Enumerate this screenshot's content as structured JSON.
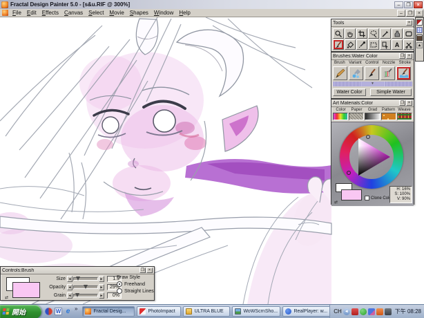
{
  "window": {
    "title": "Fractal Design Painter 5.0 - [s&u.RIF @ 300%]",
    "document": "s&u.RIF",
    "zoom_level": "300%"
  },
  "glyphs": {
    "minimize": "–",
    "restore": "❐",
    "close": "×",
    "dropdown_arrow": "▼",
    "more_chevron": "»",
    "slider_left": "◄",
    "slider_right": "►",
    "swap_arrows": "⇄",
    "scroll_up": "▲",
    "tray_collapse": "◄"
  },
  "icons": {
    "word_letter": "W",
    "ie_letter": "e",
    "text_tool_letter": "A"
  },
  "menu": {
    "items": [
      {
        "label": "File"
      },
      {
        "label": "Edit"
      },
      {
        "label": "Effects"
      },
      {
        "label": "Canvas"
      },
      {
        "label": "Select"
      },
      {
        "label": "Movie"
      },
      {
        "label": "Shapes"
      },
      {
        "label": "Window"
      },
      {
        "label": "Help"
      }
    ]
  },
  "tools_palette": {
    "title": "Tools",
    "tools": [
      "magnifier",
      "grabber",
      "crop",
      "lasso",
      "pen",
      "quick-curve",
      "rect-shape",
      "brush",
      "paint-bucket",
      "dropper",
      "rect-selection",
      "floater-adjuster",
      "text",
      "shape-cutter"
    ],
    "selected_tool": "brush"
  },
  "brushes_palette": {
    "title": "Brushes:Water Color",
    "tabs": [
      "Brush",
      "Variant",
      "Control",
      "Nozzle",
      "Stroke"
    ],
    "variants": [
      "pencil",
      "water-drops",
      "loaded-brush",
      "striped-brush",
      "water-color"
    ],
    "selected_variant": "water-color",
    "category_button": "Water Color",
    "variant_button": "Simple Water"
  },
  "art_materials_palette": {
    "title": "Art Materials:Color",
    "tabs": [
      "Color",
      "Paper",
      "Grad",
      "Pattern",
      "Weave"
    ],
    "clone_color_label": "Clone Color",
    "hsv": {
      "h": "H: 16%",
      "s": "S: 100%",
      "v": "V: 90%"
    },
    "front_color": "#f9c7f3",
    "back_color": "#ffffff"
  },
  "controls_palette": {
    "title": "Controls:Brush",
    "sliders": [
      {
        "label": "Size",
        "value": "1.9",
        "position_pct": 12
      },
      {
        "label": "Opacity",
        "value": "29%",
        "position_pct": 42
      },
      {
        "label": "Grain",
        "value": "0%",
        "position_pct": 6
      }
    ],
    "draw_style": {
      "label": "Draw Style",
      "options": [
        {
          "label": "Freehand",
          "selected": true
        },
        {
          "label": "Straight Lines",
          "selected": false
        }
      ]
    }
  },
  "taskbar": {
    "start_label": "開始",
    "quick_launch": [
      "media-player",
      "word",
      "internet-explorer"
    ],
    "tasks": [
      {
        "label": "Fractal Desig...",
        "active": true
      },
      {
        "label": "PhotoImpact",
        "active": false
      },
      {
        "label": "ULTRA BLUE",
        "active": false
      },
      {
        "label": "WoWScrnSho...",
        "active": false
      },
      {
        "label": "RealPlayer: w...",
        "active": false
      }
    ],
    "tray": {
      "language": "CH",
      "clock": "下午 08:28"
    }
  },
  "colors": {
    "selection_red": "#c52525",
    "palette_gray": "#d4d0c8",
    "taskbar_blue": "#a4b4cd",
    "start_green": "#2e8f2e"
  }
}
